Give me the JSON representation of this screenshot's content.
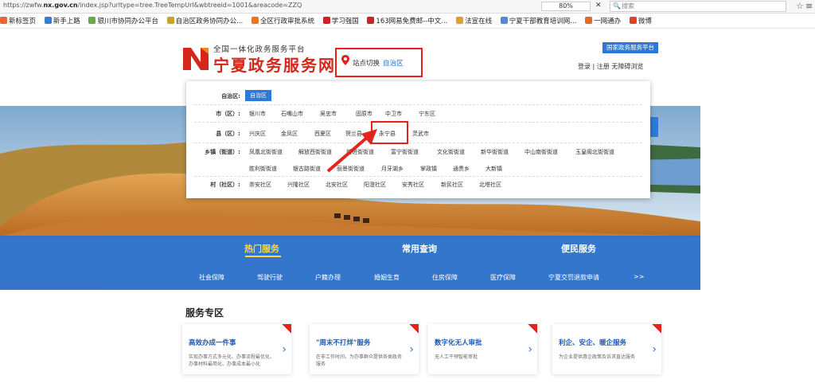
{
  "browser": {
    "url_prefix": "https://zwfw.",
    "url_host": "nx.gov.cn",
    "url_rest": "/index.jsp?urltype=tree.TreeTempUrl&wbtreeid=1001&areacode=ZZQ",
    "zoom": "80%",
    "search_placeholder": "搜索",
    "bookmarks": [
      "新标签页",
      "新手上路",
      "银川市协同办公平台",
      "自治区政务协同办公...",
      "全区行政审批系统",
      "学习强国",
      "163网易免费邮--中文...",
      "法宣在线",
      "宁夏干部教育培训网...",
      "一网通办",
      "微博"
    ],
    "bookmark_colors": [
      "#e8663d",
      "#3a7bd5",
      "#6aa84f",
      "#c9a227",
      "#e8732d",
      "#d42020",
      "#d42020",
      "#e0a030",
      "#5588cc",
      "#e86a1d",
      "#e0412d"
    ]
  },
  "header": {
    "subtitle": "全国一体化政务服务平台",
    "title": "宁夏政务服务网",
    "station_label": "站点切换",
    "station_value": "自治区",
    "national_button": "国家政务服务平台",
    "login_links": "登录 | 注册   无障碍浏览"
  },
  "region_panel": {
    "rows": [
      {
        "label": "自治区:",
        "items": [
          "自治区"
        ]
      },
      {
        "label": "市（区）:",
        "items": [
          "银川市",
          "石嘴山市",
          "吴忠市",
          "固原市",
          "中卫市",
          "宁东区"
        ]
      },
      {
        "label": "县（区）:",
        "items": [
          "兴庆区",
          "金凤区",
          "西夏区",
          "贺兰县",
          "永宁县",
          "灵武市"
        ]
      },
      {
        "label": "乡镇（街道）:",
        "items": [
          "凤凰北街街道",
          "解放西街街道",
          "前进街街道",
          "富宁街街道",
          "文化街街道",
          "新华街街道",
          "中山南街街道",
          "玉皇阁北街街道",
          "胜利街街道",
          "银古路街道",
          "丽景街街道",
          "月牙湖乡",
          "掌政镇",
          "通贵乡",
          "大新镇"
        ]
      },
      {
        "label": "村（社区）:",
        "items": [
          "崇安社区",
          "兴隆社区",
          "北安社区",
          "阳澄社区",
          "安秀社区",
          "新民社区",
          "北塔社区"
        ]
      }
    ],
    "highlighted": "永宁县"
  },
  "nav": {
    "tabs": [
      "热门服务",
      "常用查询",
      "便民服务"
    ],
    "active_tab": "热门服务",
    "subnav": [
      "社会保障",
      "驾驶行驶",
      "户籍办理",
      "婚姻生育",
      "住房保障",
      "医疗保障",
      "宁夏交罚退款申请",
      ">>"
    ]
  },
  "services": {
    "title": "服务专区",
    "cards": [
      {
        "title": "高效办成一件事",
        "desc": "实现办事方式多元化、办事流程最优化、办事材料最简化、办事成本最小化"
      },
      {
        "title": "\"周末不打烊\"服务",
        "desc": "在非工作时间，为办事群众提供各类政务服务"
      },
      {
        "title": "数字化无人审批",
        "desc": "无人工干预智能审批"
      },
      {
        "title": "利企、安企、暖企服务",
        "desc": "为企业提供惠企政策及诉求直达服务"
      }
    ]
  },
  "colors": {
    "accent": "#2d79d6",
    "band": "#2a6fc9",
    "highlight": "#e3231c",
    "title_red": "#d4261d",
    "tab_active": "#ffd83a"
  }
}
